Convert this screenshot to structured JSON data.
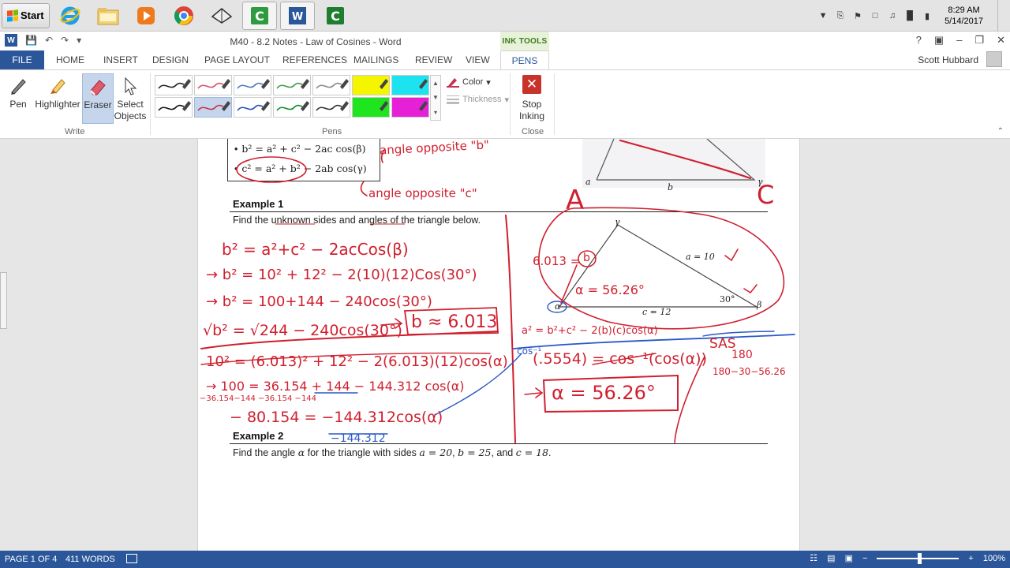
{
  "taskbar": {
    "start_label": "Start",
    "apps": [
      {
        "name": "internet-explorer-icon"
      },
      {
        "name": "file-explorer-icon"
      },
      {
        "name": "media-player-icon"
      },
      {
        "name": "chrome-icon"
      },
      {
        "name": "network-drive-icon"
      },
      {
        "name": "camtasia-icon"
      },
      {
        "name": "word-icon"
      },
      {
        "name": "camtasia-recorder-icon"
      }
    ],
    "clock_time": "8:29 AM",
    "clock_date": "5/14/2017"
  },
  "window": {
    "title": "M40 - 8.2 Notes - Law of Cosines - Word",
    "context_tab_group": "INK TOOLS",
    "controls": {
      "help": "?",
      "minimize": "–",
      "restore": "❐",
      "close": "✕"
    }
  },
  "ribbon_tabs": {
    "file": "FILE",
    "home": "HOME",
    "insert": "INSERT",
    "design": "DESIGN",
    "page_layout": "PAGE LAYOUT",
    "references": "REFERENCES",
    "mailings": "MAILINGS",
    "review": "REVIEW",
    "view": "VIEW",
    "pens": "PENS",
    "user": "Scott Hubbard"
  },
  "ribbon": {
    "write_group": {
      "pen": "Pen",
      "highlighter": "Highlighter",
      "eraser": "Eraser",
      "select_1": "Select",
      "select_2": "Objects",
      "label": "Write"
    },
    "pens_group": {
      "label": "Pens",
      "color": "Color",
      "thickness": "Thickness"
    },
    "close_group": {
      "stop_1": "Stop",
      "stop_2": "Inking",
      "label": "Close"
    },
    "pen_swatches": [
      {
        "color": "#222222",
        "bg": "#ffffff"
      },
      {
        "color": "#d4526e",
        "bg": "#ffffff"
      },
      {
        "color": "#4a78c2",
        "bg": "#ffffff"
      },
      {
        "color": "#3c9b4d",
        "bg": "#ffffff"
      },
      {
        "color": "#888888",
        "bg": "#ffffff"
      },
      {
        "color": "#f5f500",
        "bg": "#f5f500"
      },
      {
        "color": "#1de3f0",
        "bg": "#1de3f0"
      },
      {
        "color": "#111111",
        "bg": "#ffffff"
      },
      {
        "color": "#c9304f",
        "bg": "#c5d6ec"
      },
      {
        "color": "#2450b0",
        "bg": "#ffffff"
      },
      {
        "color": "#138a2a",
        "bg": "#ffffff"
      },
      {
        "color": "#333333",
        "bg": "#ffffff"
      },
      {
        "color": "#1ee51e",
        "bg": "#1ee51e"
      },
      {
        "color": "#e620d6",
        "bg": "#e620d6"
      }
    ]
  },
  "document": {
    "formulas": {
      "b_squared": "b² = a² + c² − 2ac cos(β)",
      "c_squared": "c² = a² + b² − 2ab cos(γ)"
    },
    "example1": {
      "title": "Example 1",
      "text": "Find the unknown sides and angles of the triangle below."
    },
    "example2": {
      "title": "Example 2",
      "text_pre": "Find the angle ",
      "alpha": "α",
      "text_mid": " for the triangle with sides ",
      "a_eq": "a = 20",
      "sep": ", ",
      "b_eq": "b = 25",
      "sep2": ", and ",
      "c_eq": "c = 18",
      "end": "."
    },
    "top_figure": {
      "a": "a",
      "b": "b",
      "gamma": "γ"
    },
    "ex1_figure": {
      "gamma": "γ",
      "side_a": "a = 10",
      "side_c": "c = 12",
      "alpha": "α",
      "beta": "β",
      "angle": "30°"
    },
    "ink_annotations": {
      "angle_b": "angle opposite \"b\"",
      "angle_c": "angle opposite \"c\"",
      "big_A": "A",
      "big_C": "C",
      "line1": "b² = a²+c² − 2acCos(β)",
      "line2": "→ b² = 10² + 12² − 2(10)(12)Cos(30°)",
      "line3": "→ b² = 100+144 − 240cos(30°)",
      "line4": "√b² = √244 − 240cos(30°)",
      "b_result": "b ≈ 6.013",
      "b_label": "6.013 =",
      "b_circle": "b",
      "alpha_val": "α = 56.26°",
      "cos_law_a": "a² = b²+c² − 2(b)(c)cos(α)",
      "sas": "SAS",
      "deg_180": "180",
      "deg_calc": "180−30−56.26",
      "line5": "10² = (6.013)² + 12² − 2(6.013)(12)cos(α)",
      "line6": "→ 100 = 36.154 + 144 − 144.312 cos(α)",
      "line6_sub": "−36.154−144  −36.154  −144",
      "line7": "− 80.154 = −144.312cos(α)",
      "divisor": "−144.312",
      "cos_inv": "cos⁻¹",
      "ratio": "(.5554) = cos⁻¹(cos(α))",
      "alpha_result": "α = 56.26°"
    }
  },
  "status": {
    "page": "PAGE 1 OF 4",
    "words": "411 WORDS",
    "zoom": "100%",
    "zoom_level": 1.0
  }
}
